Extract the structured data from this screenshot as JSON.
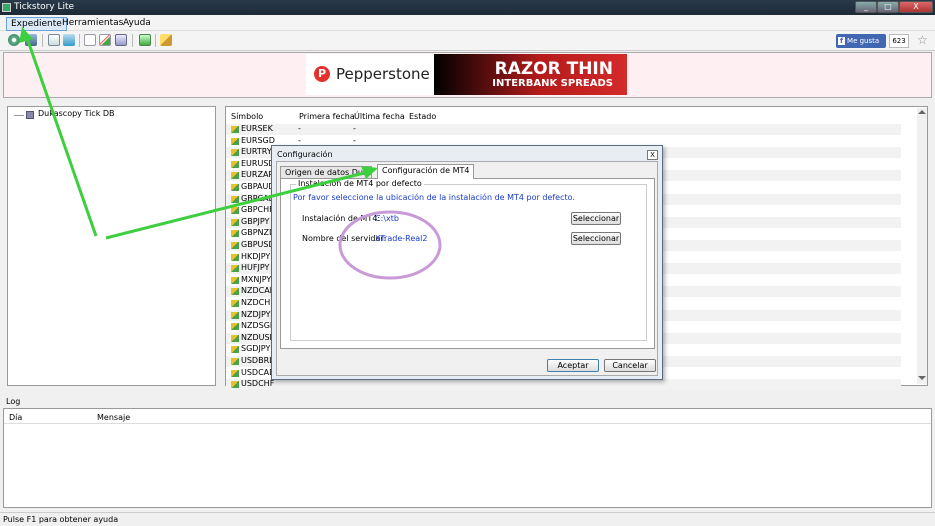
{
  "window": {
    "title": "Tickstory Lite",
    "minimize": "_",
    "maximize": "□",
    "close": "X"
  },
  "menu": [
    "Expediente",
    "Herramientas",
    "Ayuda"
  ],
  "social": {
    "like_label": "Me gusta",
    "like_icon": "f",
    "like_count": "623"
  },
  "ad": {
    "brand": "Pepperstone",
    "logo_letter": "P",
    "headline": "RAZOR THIN",
    "subline": "INTERBANK SPREADS"
  },
  "tree": {
    "root": "Dukascopy Tick DB"
  },
  "symbol_table": {
    "columns": [
      "Símbolo",
      "Primera fecha",
      "Última fecha",
      "Estado"
    ],
    "rows": [
      {
        "symbol": "EURSEK",
        "first": "-",
        "last": "-"
      },
      {
        "symbol": "EURSGD",
        "first": "-",
        "last": "-"
      },
      {
        "symbol": "EURTRY",
        "first": "",
        "last": ""
      },
      {
        "symbol": "EURUSD",
        "first": "",
        "last": ""
      },
      {
        "symbol": "EURZAR",
        "first": "",
        "last": ""
      },
      {
        "symbol": "GBPAUD",
        "first": "",
        "last": ""
      },
      {
        "symbol": "GBPCAD",
        "first": "",
        "last": ""
      },
      {
        "symbol": "GBPCHF",
        "first": "",
        "last": ""
      },
      {
        "symbol": "GBPJPY",
        "first": "",
        "last": ""
      },
      {
        "symbol": "GBPNZD",
        "first": "",
        "last": ""
      },
      {
        "symbol": "GBPUSD",
        "first": "",
        "last": ""
      },
      {
        "symbol": "HKDJPY",
        "first": "",
        "last": ""
      },
      {
        "symbol": "HUFJPY",
        "first": "",
        "last": ""
      },
      {
        "symbol": "MXNJPY",
        "first": "",
        "last": ""
      },
      {
        "symbol": "NZDCAD",
        "first": "",
        "last": ""
      },
      {
        "symbol": "NZDCHF",
        "first": "",
        "last": ""
      },
      {
        "symbol": "NZDJPY",
        "first": "",
        "last": ""
      },
      {
        "symbol": "NZDSGD",
        "first": "",
        "last": ""
      },
      {
        "symbol": "NZDUSD",
        "first": "",
        "last": ""
      },
      {
        "symbol": "SGDJPY",
        "first": "",
        "last": ""
      },
      {
        "symbol": "USDBRL",
        "first": "",
        "last": ""
      },
      {
        "symbol": "USDCAD",
        "first": "",
        "last": ""
      },
      {
        "symbol": "USDCHF",
        "first": "",
        "last": ""
      }
    ]
  },
  "log": {
    "title": "Log",
    "columns": [
      "Día",
      "Mensaje"
    ]
  },
  "status_bar": "Pulse F1 para obtener ayuda",
  "dialog": {
    "title": "Configuración",
    "close": "X",
    "tabs": [
      "Origen de datos Dukascopy",
      "Configuración de MT4"
    ],
    "group_title": "Instalación de MT4 por defecto",
    "instruction": "Por favor seleccione la ubicación de la instalación de MT4 por defecto.",
    "install_label": "Instalación de MT4:",
    "install_value": "C:\\xtb",
    "server_label": "Nombre del servidor:",
    "server_value": "XTrade-Real2",
    "select_button": "Seleccionar",
    "ok_button": "Aceptar",
    "cancel_button": "Cancelar"
  },
  "colors": {
    "annotation_arrow": "#3ecf3e",
    "annotation_ellipse": "#c89ad8",
    "ad_red": "#d42a2a",
    "fb_blue": "#4267b2",
    "link_blue": "#1a3cc8"
  }
}
